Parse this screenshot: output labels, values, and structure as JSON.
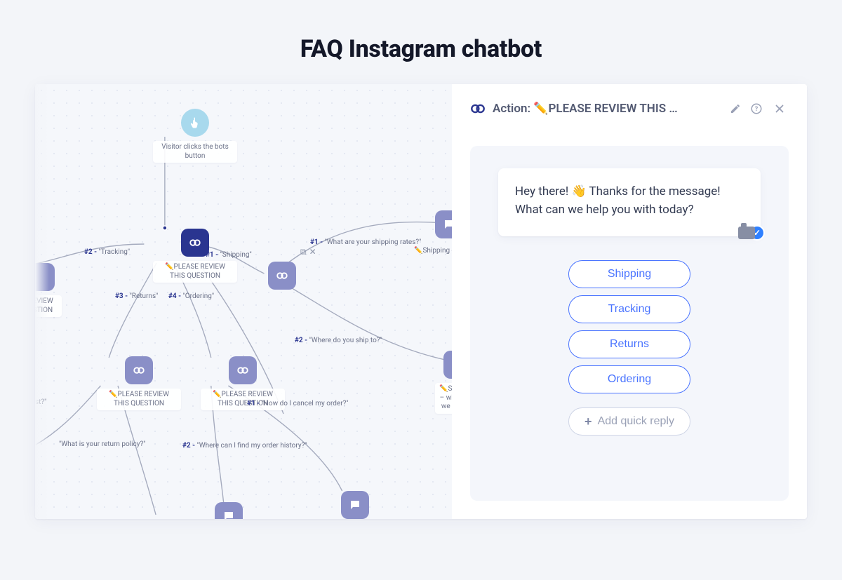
{
  "page": {
    "title": "FAQ Instagram chatbot"
  },
  "panel": {
    "title_prefix": "Action: ",
    "title_emoji": "✏️",
    "title_text": "PLEASE REVIEW THIS …",
    "message": "Hey there! 👋 Thanks for the message! What can we help you with today?",
    "quick_replies": [
      "Shipping",
      "Tracking",
      "Returns",
      "Ordering"
    ],
    "add_label": "Add quick reply"
  },
  "canvas": {
    "trigger_label": "Visitor clicks the bots button",
    "review_label": "✏️PLEASE REVIEW THIS QUESTION",
    "review_label2": "✏️PLEASE REVIEW THIS QUESTION",
    "review_label3": "✏️PLEASE REVIEW THIS QUESTION",
    "edge_left_cut_label": "REVIEW ESTION",
    "edge_right_cut_label": "✏️Shipping – where do we ship to",
    "edges": {
      "e1": {
        "tag": "#1 -",
        "txt": "\"Shipping\""
      },
      "e2": {
        "tag": "#2 -",
        "txt": "\"Tracking\""
      },
      "e3": {
        "tag": "#3 -",
        "txt": "\"Returns\""
      },
      "e4": {
        "tag": "#4 -",
        "txt": "\"Ordering\""
      },
      "e5": {
        "tag": "#1 -",
        "txt": "\"What are your shipping rates?\""
      },
      "e6": {
        "txt": "✏️Shipping -"
      },
      "e7": {
        "tag": "#2 -",
        "txt": "\"Where do you ship to?\""
      },
      "e8": {
        "tag": "#1 -",
        "txt": "\"How do I cancel my order?\""
      },
      "e9": {
        "tag": "#2 -",
        "txt": "\"Where can I find my order history?\""
      },
      "e10": {
        "txt": "\"What is your return policy?\""
      },
      "e11": {
        "txt": "st?\""
      }
    }
  }
}
